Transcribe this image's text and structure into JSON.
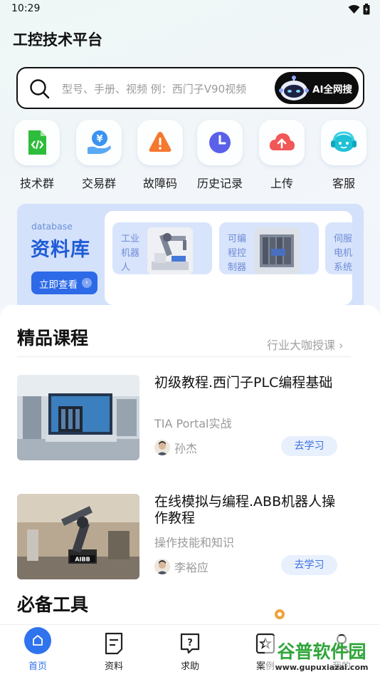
{
  "status": {
    "time": "10:29"
  },
  "app": {
    "title": "工控技术平台"
  },
  "search": {
    "placeholder": "型号、手册、视频 例：西门子V90视频",
    "ai_button_label": "AI全网搜"
  },
  "quick_actions": [
    {
      "label": "技术群",
      "icon": "code-file-icon",
      "color": "#2dbd3a"
    },
    {
      "label": "交易群",
      "icon": "yuan-hand-icon",
      "color": "#3a93f0"
    },
    {
      "label": "故障码",
      "icon": "warning-icon",
      "color": "#f5782e"
    },
    {
      "label": "历史记录",
      "icon": "clock-icon",
      "color": "#5a61e8"
    },
    {
      "label": "上传",
      "icon": "cloud-upload-icon",
      "color": "#f25757"
    },
    {
      "label": "客服",
      "icon": "headset-icon",
      "color": "#1fc1d6"
    }
  ],
  "database": {
    "eng_label": "database",
    "title": "资料库",
    "view_button": "立即查看",
    "cards": [
      {
        "label": "工业机器人"
      },
      {
        "label": "可编程控制器"
      },
      {
        "label": "伺服电机系统"
      }
    ]
  },
  "courses_section": {
    "title": "精品课程",
    "more_label": "行业大咖授课 ›",
    "items": [
      {
        "title": "初级教程.西门子PLC编程基础",
        "subtitle": "TIA Portal实战",
        "author": "孙杰",
        "button": "去学习"
      },
      {
        "title": "在线模拟与编程.ABB机器人操作教程",
        "subtitle": "操作技能和知识",
        "author": "李裕应",
        "button": "去学习"
      }
    ]
  },
  "tools_section": {
    "title": "必备工具"
  },
  "bottom_nav": [
    {
      "label": "首页",
      "icon": "home-icon",
      "active": true
    },
    {
      "label": "资料",
      "icon": "document-icon",
      "active": false
    },
    {
      "label": "求助",
      "icon": "help-icon",
      "active": false
    },
    {
      "label": "案例",
      "icon": "case-star-icon",
      "active": false
    },
    {
      "label": "我的",
      "icon": "user-icon",
      "active": false
    }
  ],
  "watermark": {
    "text": "谷普软件园",
    "url_text": "www.gupuxiazai.com"
  },
  "colors": {
    "accent": "#2f73ee",
    "database_title": "#1e5bd6"
  }
}
